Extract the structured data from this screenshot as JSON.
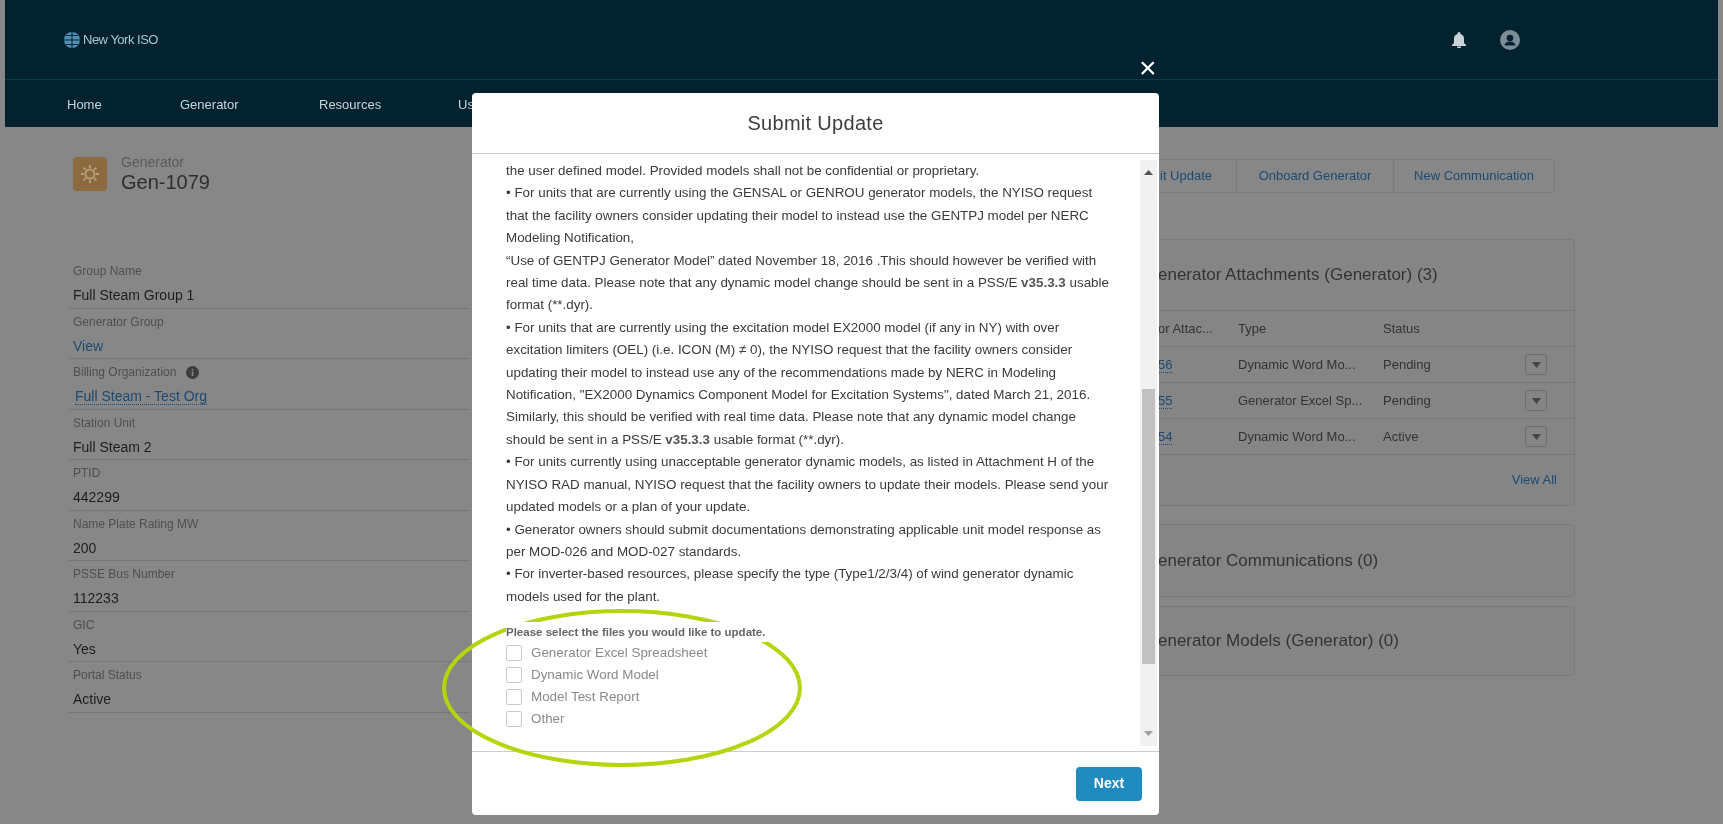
{
  "header": {
    "logo": "New York ISO",
    "nav": [
      {
        "label": "Home"
      },
      {
        "label": "Generator"
      },
      {
        "label": "Resources"
      },
      {
        "label": "Us"
      }
    ]
  },
  "record": {
    "type_label": "Generator",
    "name": "Gen-1079"
  },
  "fields": [
    {
      "label": "Group Name",
      "value": "Full Steam Group 1",
      "kind": "text",
      "info": false
    },
    {
      "label": "Generator Group",
      "value": "View",
      "kind": "link",
      "info": false
    },
    {
      "label": "Billing Organization",
      "value": "Full Steam - Test Org",
      "kind": "lookup",
      "info": true
    },
    {
      "label": "Station Unit",
      "value": "Full Steam 2",
      "kind": "text",
      "info": false
    },
    {
      "label": "PTID",
      "value": "442299",
      "kind": "text",
      "info": false
    },
    {
      "label": "Name Plate Rating MW",
      "value": "200",
      "kind": "text",
      "info": false
    },
    {
      "label": "PSSE Bus Number",
      "value": "112233",
      "kind": "text",
      "info": false
    },
    {
      "label": "GIC",
      "value": "Yes",
      "kind": "text",
      "info": false
    },
    {
      "label": "Portal Status",
      "value": "Active",
      "kind": "text",
      "info": false
    }
  ],
  "actions": [
    "it Update",
    "Onboard Generator",
    "New Communication"
  ],
  "attachments": {
    "title": "enerator Attachments (Generator) (3)",
    "columns": [
      "or Attac...",
      "Type",
      "Status"
    ],
    "rows": [
      {
        "cells": [
          "56",
          "Dynamic Word Mo...",
          "Pending"
        ]
      },
      {
        "cells": [
          "55",
          "Generator Excel Sp...",
          "Pending"
        ]
      },
      {
        "cells": [
          "54",
          "Dynamic Word Mo...",
          "Active"
        ]
      }
    ],
    "view_all": "View All"
  },
  "related": [
    {
      "title": "enerator Communications (0)"
    },
    {
      "title": "enerator Models (Generator) (0)"
    }
  ],
  "modal": {
    "close": "×",
    "title": "Submit Update",
    "paragraphs": [
      [
        {
          "text": "the user defined model. Provided models shall not be confidential or proprietary.",
          "bold": false
        }
      ],
      [
        {
          "text": "• For units that are currently using the GENSAL or GENROU generator models, the NYISO request that the facility owners consider updating their model to instead use the GENTPJ model per NERC Modeling Notification,",
          "bold": false
        }
      ],
      [
        {
          "text": "“Use of GENTPJ Generator Model” dated November 18, 2016 .This should however be verified with real time data. Please note that any dynamic model change should be sent in a PSS/E ",
          "bold": false
        },
        {
          "text": "v35.3.3",
          "bold": true
        },
        {
          "text": " usable format (**.dyr).",
          "bold": false
        }
      ],
      [
        {
          "text": "• For units that are currently using the excitation model EX2000 model (if any in NY) with over excitation limiters (OEL) (i.e. ICON (M) ≠ 0), the NYISO request that the facility owners consider updating their model to instead use any of the recommendations made by NERC in Modeling Notification, \"EX2000 Dynamics Component Model for Excitation Systems\", dated March 21, 2016. Similarly, this should be verified with real time data. Please note that any dynamic model change should be sent in a PSS/E ",
          "bold": false
        },
        {
          "text": "v35.3.3",
          "bold": true
        },
        {
          "text": " usable format (**.dyr).",
          "bold": false
        }
      ],
      [
        {
          "text": "• For units currently using unacceptable generator dynamic models, as listed in Attachment H of the NYISO RAD manual, NYISO request that the facility owners to update their models. Please send your updated models or a plan of your update.",
          "bold": false
        }
      ],
      [
        {
          "text": "• Generator owners should submit documentations demonstrating applicable unit model response as per MOD-026 and MOD-027 standards.",
          "bold": false
        }
      ],
      [
        {
          "text": "• For inverter-based resources, please specify the type (Type1/2/3/4) of wind generator dynamic models used for the plant.",
          "bold": false
        }
      ]
    ],
    "prompt": "Please select the files you would like to update.",
    "options": [
      {
        "label": "Generator Excel Spreadsheet",
        "checked": false
      },
      {
        "label": "Dynamic Word Model",
        "checked": false
      },
      {
        "label": "Model Test Report",
        "checked": false
      },
      {
        "label": "Other",
        "checked": false
      }
    ],
    "button": "Next"
  }
}
